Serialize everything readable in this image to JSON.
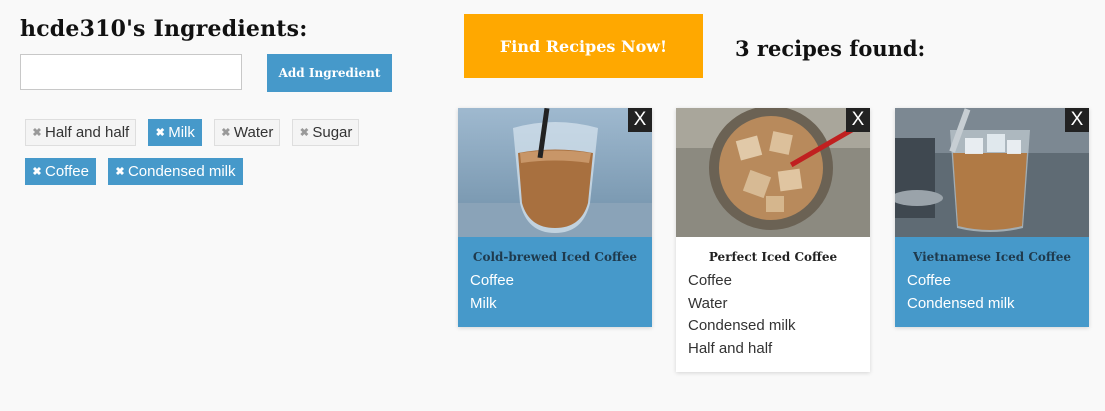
{
  "ingredients_panel": {
    "title": "hcde310's Ingredients:",
    "input_value": "",
    "add_button": "Add Ingredient",
    "tags": [
      {
        "label": "Half and half",
        "selected": false
      },
      {
        "label": "Milk",
        "selected": true
      },
      {
        "label": "Water",
        "selected": false
      },
      {
        "label": "Sugar",
        "selected": false
      },
      {
        "label": "Coffee",
        "selected": true
      },
      {
        "label": "Condensed milk",
        "selected": true
      }
    ]
  },
  "results": {
    "find_button": "Find Recipes Now!",
    "found_text": "3 recipes found:",
    "recipes": [
      {
        "name": "Cold-brewed Iced Coffee",
        "ingredients": [
          "Coffee",
          "Milk"
        ],
        "style": "blue",
        "close": "X"
      },
      {
        "name": "Perfect Iced Coffee",
        "ingredients": [
          "Coffee",
          "Water",
          "Condensed milk",
          "Half and half"
        ],
        "style": "white",
        "close": "X"
      },
      {
        "name": "Vietnamese Iced Coffee",
        "ingredients": [
          "Coffee",
          "Condensed milk"
        ],
        "style": "blue",
        "close": "X"
      }
    ]
  },
  "colors": {
    "accent_blue": "#4699ca",
    "find_orange": "#ffa800",
    "background": "#f9f9f9"
  }
}
